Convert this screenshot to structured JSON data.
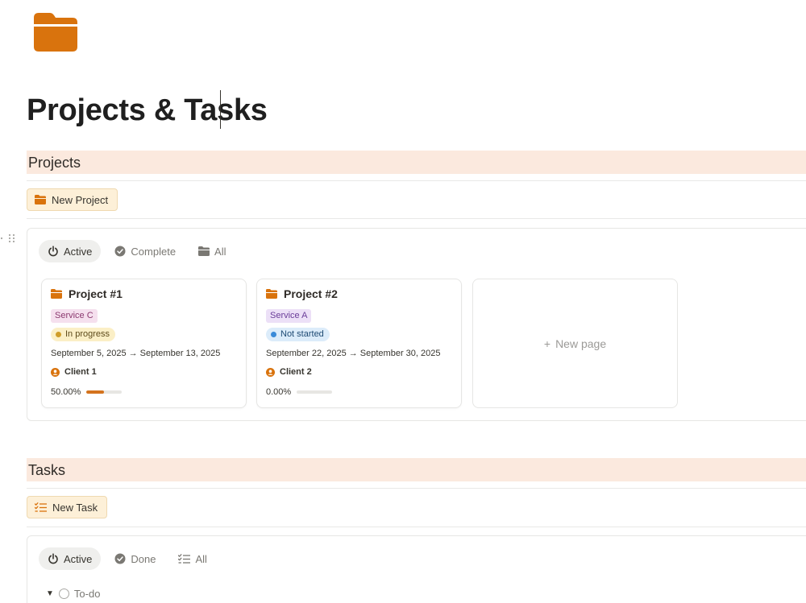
{
  "page": {
    "title": "Projects & Tasks",
    "icon": "folder-icon",
    "accent_color": "#d9730d",
    "section_bg": "#fbe9de"
  },
  "projects_section": {
    "header": "Projects",
    "new_button": {
      "label": "New Project",
      "icon": "folder-icon"
    },
    "views": [
      {
        "label": "Active",
        "icon": "power-icon",
        "active": true
      },
      {
        "label": "Complete",
        "icon": "check-circle-icon",
        "active": false
      },
      {
        "label": "All",
        "icon": "folder-icon",
        "active": false
      }
    ],
    "cards": [
      {
        "title": "Project #1",
        "service": "Service C",
        "status": "In progress",
        "dates": "September 5, 2025 → September 13, 2025",
        "client": "Client 1",
        "progress_label": "50.00%",
        "progress": 0.5
      },
      {
        "title": "Project #2",
        "service": "Service A",
        "status": "Not started",
        "dates": "September 22, 2025 → September 30, 2025",
        "client": "Client 2",
        "progress_label": "0.00%",
        "progress": 0.0
      }
    ],
    "new_page": {
      "plus": "+",
      "label": "New page"
    }
  },
  "tasks_section": {
    "header": "Tasks",
    "new_button": {
      "label": "New Task",
      "icon": "checklist-icon"
    },
    "views": [
      {
        "label": "Active",
        "icon": "power-icon",
        "active": true
      },
      {
        "label": "Done",
        "icon": "check-circle-icon",
        "active": false
      },
      {
        "label": "All",
        "icon": "checklist-icon",
        "active": false
      }
    ],
    "group": {
      "toggle": "▼",
      "label": "To-do"
    }
  }
}
